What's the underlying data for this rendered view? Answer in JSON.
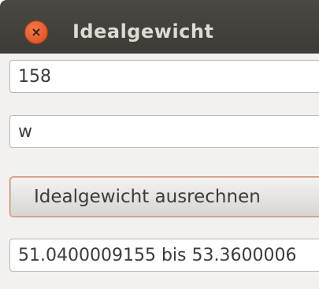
{
  "window": {
    "title": "Idealgewicht"
  },
  "form": {
    "height_value": "158",
    "gender_value": "w",
    "calculate_label": "Idealgewicht ausrechnen",
    "result_value": "51.0400009155 bis 53.3600006"
  },
  "icons": {
    "close": "close-icon"
  },
  "colors": {
    "titlebar": "#3c3b37",
    "close_button": "#e2562c",
    "button_focus_border": "#e07a52",
    "window_background": "#f2f1f0"
  }
}
